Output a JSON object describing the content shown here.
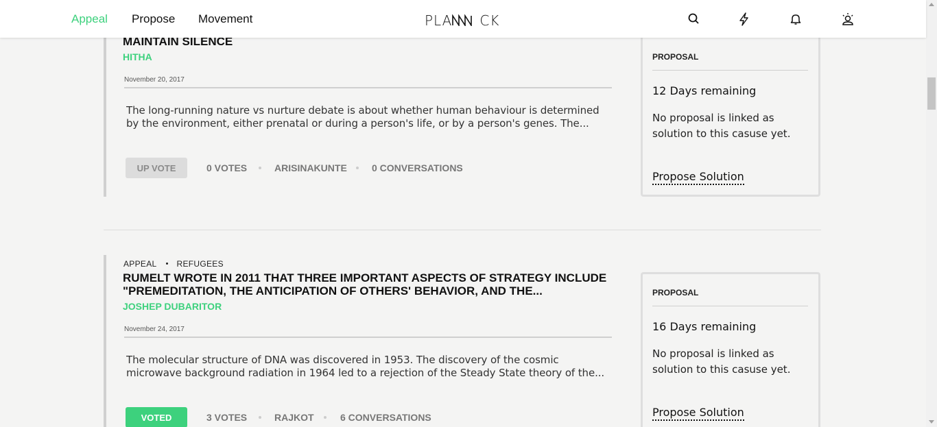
{
  "nav": {
    "links": [
      "Appeal",
      "Propose",
      "Movement"
    ],
    "logo": "PLANNICK",
    "accent_color": "#3dd17d"
  },
  "icons": [
    "search-icon",
    "lightning-icon",
    "bell-icon",
    "user-icon"
  ],
  "posts": [
    {
      "category": "",
      "topic": "",
      "title": "MAINTAIN SILENCE",
      "author": "HITHA",
      "date": "November 20, 2017",
      "excerpt": "The long-running nature vs nurture debate is about whether human behaviour is determined by the environment, either prenatal or during a person's life, or by a person's genes. The...",
      "vote_label": "UP VOTE",
      "votes": "0 VOTES",
      "location": "ARISINAKUNTE",
      "conversations": "0 CONVERSATIONS",
      "proposal": {
        "label": "PROPOSAL",
        "days_remaining": "12 Days remaining",
        "text": "No proposal is linked as solution to this casuse yet.",
        "link": "Propose Solution"
      }
    },
    {
      "category": "APPEAL",
      "topic": "REFUGEES",
      "title": "RUMELT WROTE IN 2011 THAT THREE IMPORTANT ASPECTS OF STRATEGY INCLUDE \"PREMEDITATION, THE ANTICIPATION OF OTHERS' BEHAVIOR, AND THE...",
      "author": "JOSHEP DUBARITOR",
      "date": "November 24, 2017",
      "excerpt": "The molecular structure of DNA was discovered in 1953. The discovery of the cosmic microwave background radiation in 1964 led to a rejection of the Steady State theory of the...",
      "vote_label": "VOTED",
      "votes": "3 VOTES",
      "location": "RAJKOT",
      "conversations": "6 CONVERSATIONS",
      "proposal": {
        "label": "PROPOSAL",
        "days_remaining": "16 Days remaining",
        "text": "No proposal is linked as solution to this casuse yet.",
        "link": "Propose Solution"
      }
    }
  ]
}
